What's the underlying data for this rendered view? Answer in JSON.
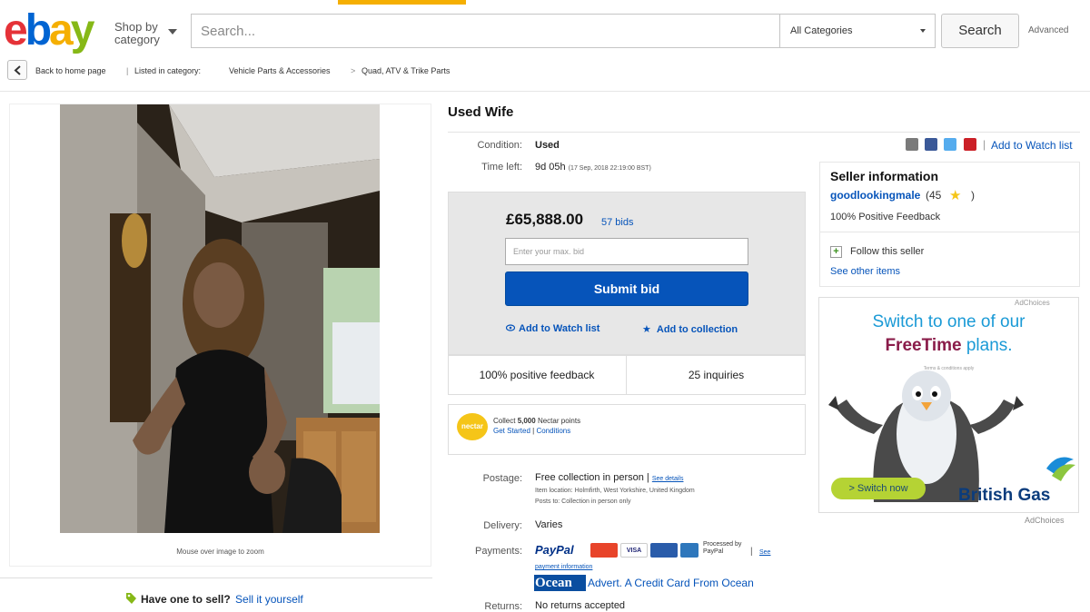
{
  "header": {
    "logo": [
      "e",
      "b",
      "a",
      "y"
    ],
    "shop_by": "Shop by category",
    "search_placeholder": "Search...",
    "category": "All Categories",
    "search_button": "Search",
    "advanced": "Advanced"
  },
  "breadcrumb": {
    "back": "Back to home page",
    "listed": "Listed in category:",
    "cat1": "Vehicle Parts & Accessories",
    "sep": ">",
    "cat2": "Quad, ATV & Trike Parts"
  },
  "listing": {
    "title": "Used Wife",
    "condition_label": "Condition:",
    "condition": "Used",
    "time_left_label": "Time left:",
    "time_left": "9d 05h",
    "end_time": "(17 Sep, 2018   22:19:00 BST)",
    "zoom_hint": "Mouse over image to zoom",
    "have_one": "Have one to sell?",
    "sell_it": "Sell it yourself"
  },
  "bid": {
    "price": "£65,888.00",
    "bids": "57 bids",
    "max_placeholder": "Enter your max. bid",
    "submit": "Submit bid",
    "watch": "Add to Watch list",
    "collection": "Add to collection",
    "positive": "100% positive feedback",
    "inquiries": "25 inquiries"
  },
  "nectar": {
    "logo": "nectar",
    "line1_pre": "Collect",
    "line1_bold": "5,000",
    "line1_post": "Nectar points",
    "get_started": "Get Started",
    "conditions": "Conditions"
  },
  "details": {
    "postage_label": "Postage:",
    "postage": "Free collection in person",
    "see_details": "See details",
    "item_location": "Item location: Holmfirth, West Yorkshire, United Kingdom",
    "posts_to": "Posts to: Collection in person only",
    "delivery_label": "Delivery:",
    "delivery": "Varies",
    "payments_label": "Payments:",
    "paypal": "PayPal",
    "visa": "VISA",
    "processed": "Processed by PayPal",
    "see": "See",
    "payment_info": "payment information",
    "ocean_logo": "Ocean",
    "ocean_text": "Advert. A Credit Card From Ocean",
    "returns_label": "Returns:",
    "returns": "No returns accepted"
  },
  "share": {
    "watch_list": "Add to Watch list",
    "colors": [
      "#7a7a7a",
      "#3b5998",
      "#55acee",
      "#cb2027"
    ]
  },
  "seller": {
    "heading": "Seller information",
    "name": "goodlookingmale",
    "score": "(45",
    "close": ")",
    "feedback": "100% Positive Feedback",
    "follow": "Follow this seller",
    "other_items": "See other items"
  },
  "ad": {
    "adchoices": "AdChoices",
    "line1": "Switch to one of our",
    "line2_bold": "FreeTime",
    "line2_rest": "plans.",
    "fine": "Terms & conditions apply",
    "switch": "> Switch now",
    "brand": "British Gas",
    "adchoices_bottom": "AdChoices"
  },
  "colors": {
    "ebay_red": "#e53238",
    "ebay_blue": "#0064d2",
    "ebay_yellow": "#f5af02",
    "ebay_green": "#86b817",
    "link": "#0654ba",
    "bid_button": "#0654ba"
  }
}
